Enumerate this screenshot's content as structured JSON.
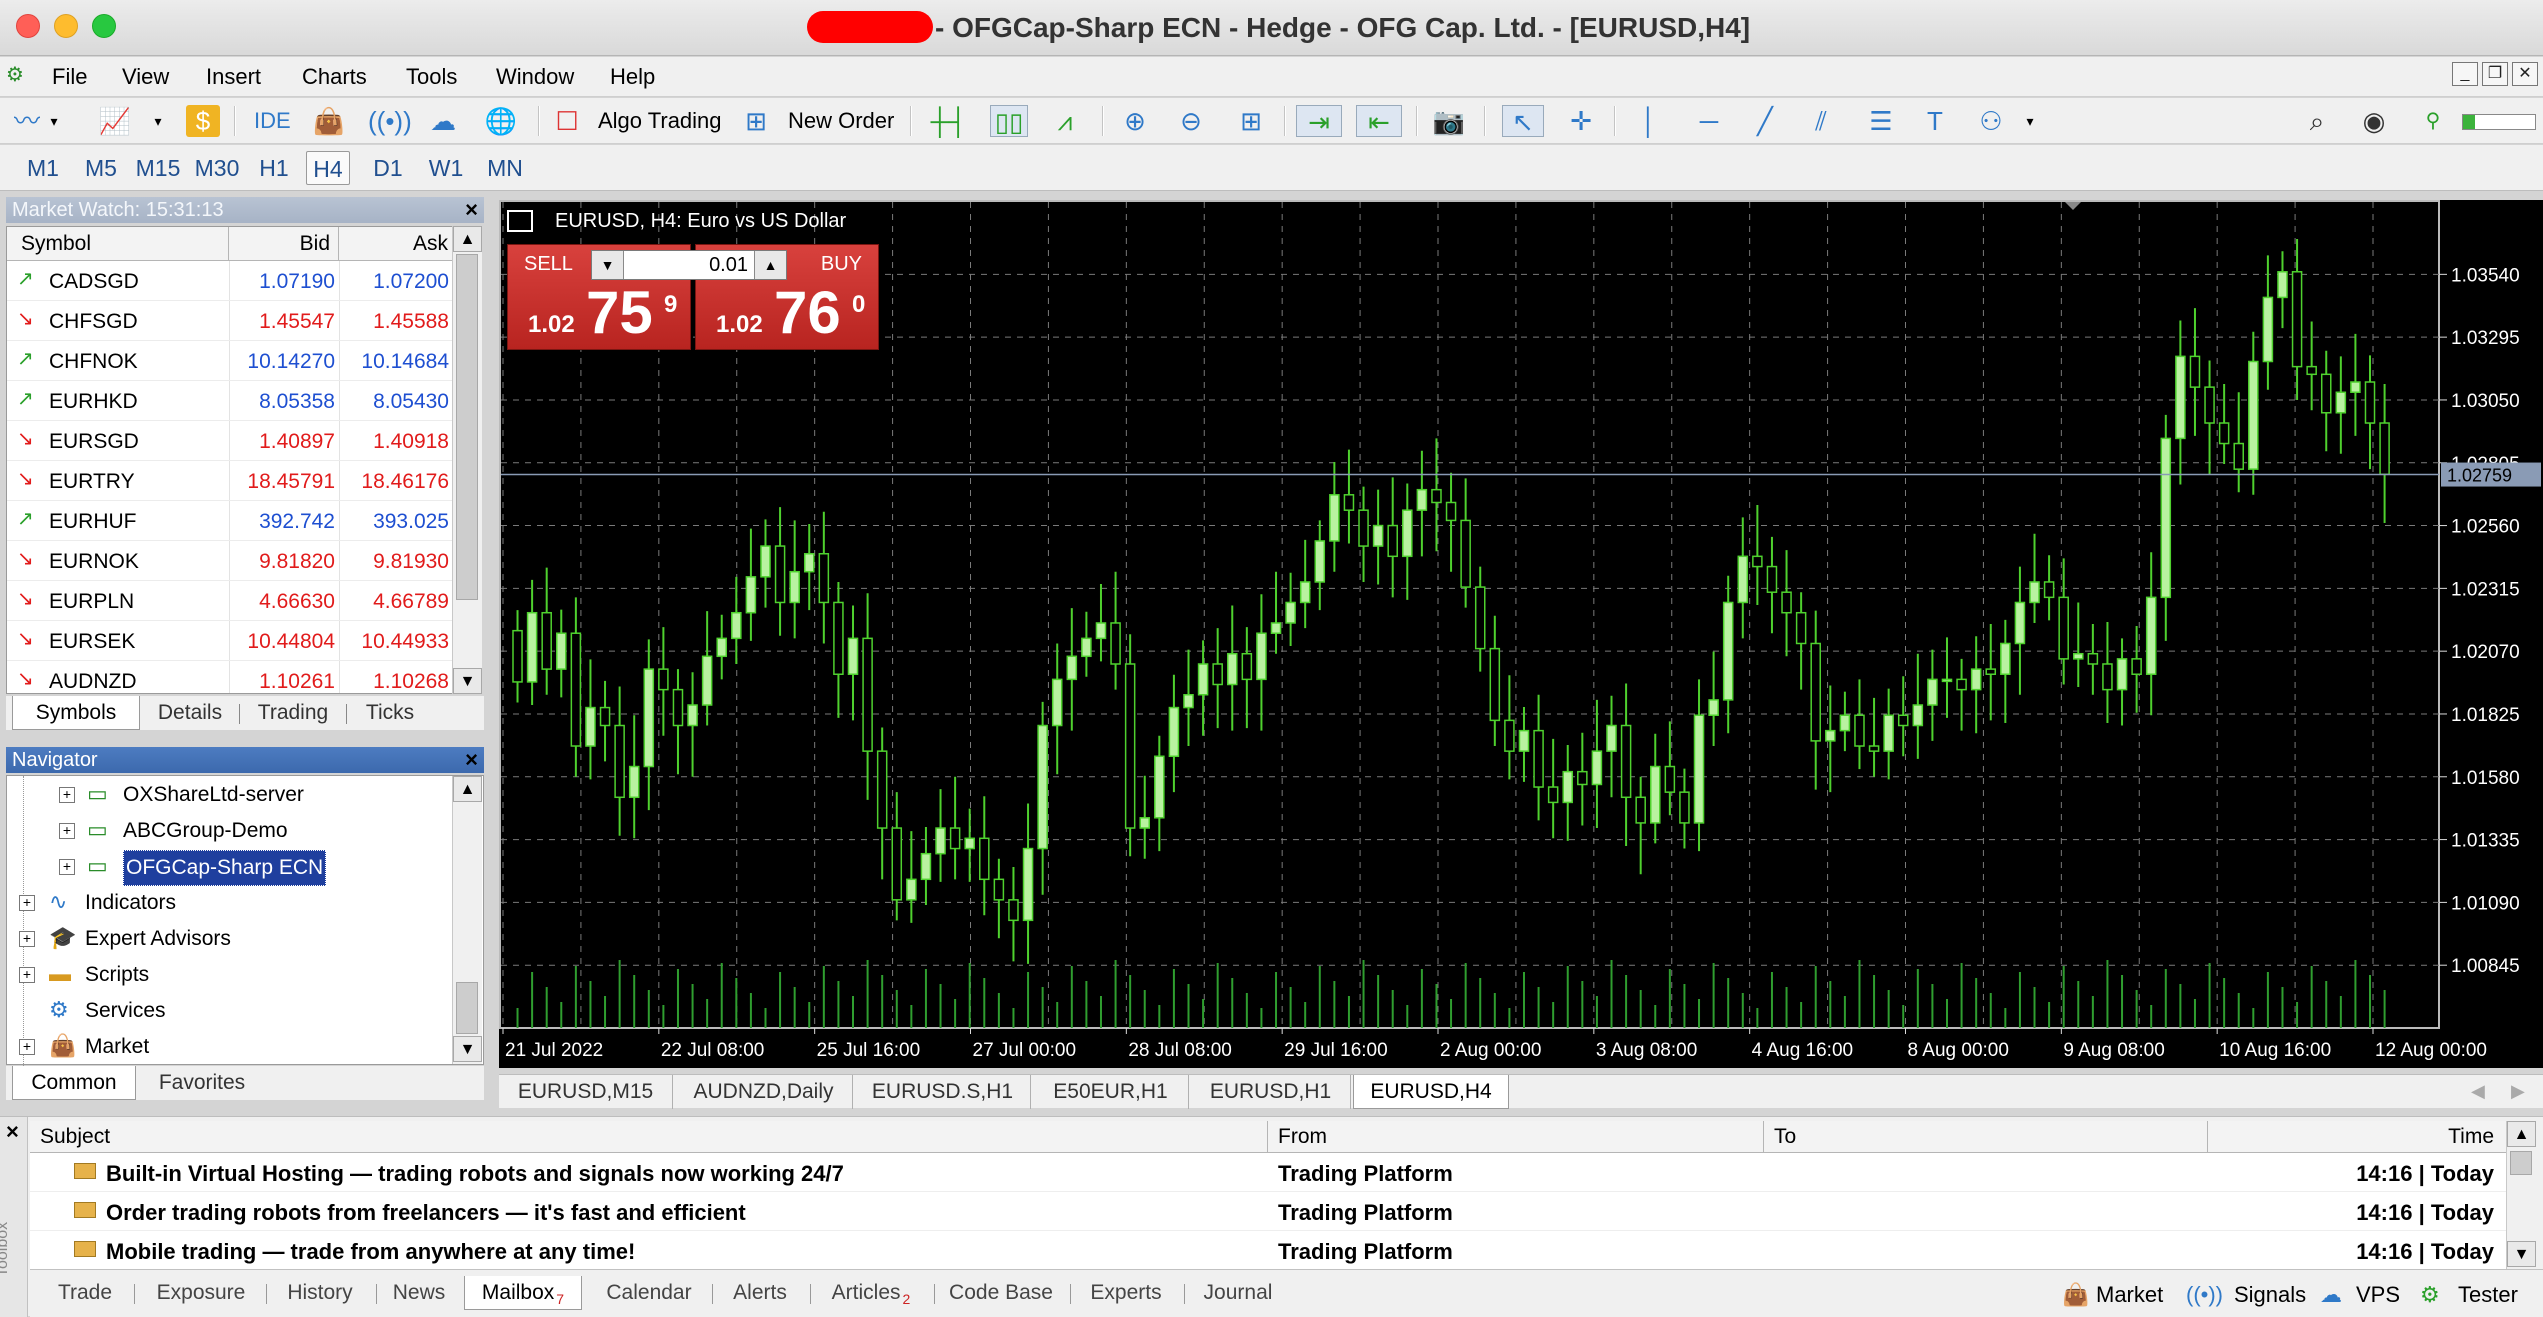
{
  "window": {
    "title": "- OFGCap-Sharp ECN - Hedge - OFG Cap. Ltd. - [EURUSD,H4]"
  },
  "menu": [
    "File",
    "View",
    "Insert",
    "Charts",
    "Tools",
    "Window",
    "Help"
  ],
  "toolbar": {
    "ide": "IDE",
    "algo_trading": "Algo Trading",
    "new_order": "New Order"
  },
  "timeframes": [
    "M1",
    "M5",
    "M15",
    "M30",
    "H1",
    "H4",
    "D1",
    "W1",
    "MN"
  ],
  "active_timeframe": "H4",
  "market_watch": {
    "title": "Market Watch: 15:31:13",
    "columns": [
      "Symbol",
      "Bid",
      "Ask"
    ],
    "rows": [
      {
        "symbol": "CADSGD",
        "bid": "1.07190",
        "ask": "1.07200",
        "dir": "up"
      },
      {
        "symbol": "CHFSGD",
        "bid": "1.45547",
        "ask": "1.45588",
        "dir": "down"
      },
      {
        "symbol": "CHFNOK",
        "bid": "10.14270",
        "ask": "10.14684",
        "dir": "up"
      },
      {
        "symbol": "EURHKD",
        "bid": "8.05358",
        "ask": "8.05430",
        "dir": "up"
      },
      {
        "symbol": "EURSGD",
        "bid": "1.40897",
        "ask": "1.40918",
        "dir": "down"
      },
      {
        "symbol": "EURTRY",
        "bid": "18.45791",
        "ask": "18.46176",
        "dir": "down"
      },
      {
        "symbol": "EURHUF",
        "bid": "392.742",
        "ask": "393.025",
        "dir": "up"
      },
      {
        "symbol": "EURNOK",
        "bid": "9.81820",
        "ask": "9.81930",
        "dir": "down"
      },
      {
        "symbol": "EURPLN",
        "bid": "4.66630",
        "ask": "4.66789",
        "dir": "down"
      },
      {
        "symbol": "EURSEK",
        "bid": "10.44804",
        "ask": "10.44933",
        "dir": "down"
      },
      {
        "symbol": "AUDNZD",
        "bid": "1.10261",
        "ask": "1.10268",
        "dir": "down"
      }
    ],
    "tabs": [
      "Symbols",
      "Details",
      "Trading",
      "Ticks"
    ]
  },
  "navigator": {
    "title": "Navigator",
    "items": [
      {
        "label": "OXShareLtd-server",
        "level": 2,
        "icon": "server",
        "selected": false
      },
      {
        "label": "ABCGroup-Demo",
        "level": 2,
        "icon": "server",
        "selected": false
      },
      {
        "label": "OFGCap-Sharp ECN",
        "level": 2,
        "icon": "server",
        "selected": true
      },
      {
        "label": "Indicators",
        "level": 1,
        "icon": "indicator",
        "selected": false
      },
      {
        "label": "Expert Advisors",
        "level": 1,
        "icon": "expert",
        "selected": false
      },
      {
        "label": "Scripts",
        "level": 1,
        "icon": "script",
        "selected": false
      },
      {
        "label": "Services",
        "level": 1,
        "icon": "service",
        "selected": false
      },
      {
        "label": "Market",
        "level": 1,
        "icon": "market",
        "selected": false
      }
    ],
    "tabs": [
      "Common",
      "Favorites"
    ]
  },
  "chart": {
    "info": "EURUSD, H4:  Euro vs US Dollar",
    "sell_label": "SELL",
    "buy_label": "BUY",
    "lot": "0.01",
    "sell_price": {
      "prefix": "1.02",
      "big": "75",
      "sup": "9"
    },
    "buy_price": {
      "prefix": "1.02",
      "big": "76",
      "sup": "0"
    },
    "price_labels": [
      "1.03540",
      "1.03295",
      "1.03050",
      "1.02805",
      "1.02560",
      "1.02315",
      "1.02070",
      "1.01825",
      "1.01580",
      "1.01335",
      "1.01090",
      "1.00845"
    ],
    "current_price": "1.02759",
    "time_labels": [
      "21 Jul 2022",
      "22 Jul 08:00",
      "25 Jul 16:00",
      "27 Jul 00:00",
      "28 Jul 08:00",
      "29 Jul 16:00",
      "2 Aug 00:00",
      "3 Aug 08:00",
      "4 Aug 16:00",
      "8 Aug 00:00",
      "9 Aug 08:00",
      "10 Aug 16:00",
      "12 Aug 00:00"
    ],
    "colors": {
      "up": "#b9f2a0",
      "wick": "#4fd12e",
      "grid": "#7a7a7a",
      "price_line": "#8a9bb5"
    }
  },
  "chart_tabs": [
    "EURUSD,M15",
    "AUDNZD,Daily",
    "EURUSD.S,H1",
    "E50EUR,H1",
    "EURUSD,H1",
    "EURUSD,H4"
  ],
  "active_chart_tab": "EURUSD,H4",
  "toolbox": {
    "side_label": "Toolbox",
    "columns": [
      "Subject",
      "From",
      "To",
      "Time"
    ],
    "rows": [
      {
        "subject": "Built-in Virtual Hosting — trading robots and signals now working 24/7",
        "from": "Trading Platform",
        "to": "",
        "time": "14:16 | Today"
      },
      {
        "subject": "Order trading robots from freelancers — it's fast and efficient",
        "from": "Trading Platform",
        "to": "",
        "time": "14:16 | Today"
      },
      {
        "subject": "Mobile trading — trade from anywhere at any time!",
        "from": "Trading Platform",
        "to": "",
        "time": "14:16 | Today"
      }
    ],
    "tabs": [
      {
        "label": "Trade",
        "badge": ""
      },
      {
        "label": "Exposure",
        "badge": ""
      },
      {
        "label": "History",
        "badge": ""
      },
      {
        "label": "News",
        "badge": ""
      },
      {
        "label": "Mailbox",
        "badge": "7"
      },
      {
        "label": "Calendar",
        "badge": ""
      },
      {
        "label": "Alerts",
        "badge": ""
      },
      {
        "label": "Articles",
        "badge": "2"
      },
      {
        "label": "Code Base",
        "badge": ""
      },
      {
        "label": "Experts",
        "badge": ""
      },
      {
        "label": "Journal",
        "badge": ""
      }
    ],
    "active_tab": "Mailbox",
    "status": [
      "Market",
      "Signals",
      "VPS",
      "Tester"
    ]
  }
}
